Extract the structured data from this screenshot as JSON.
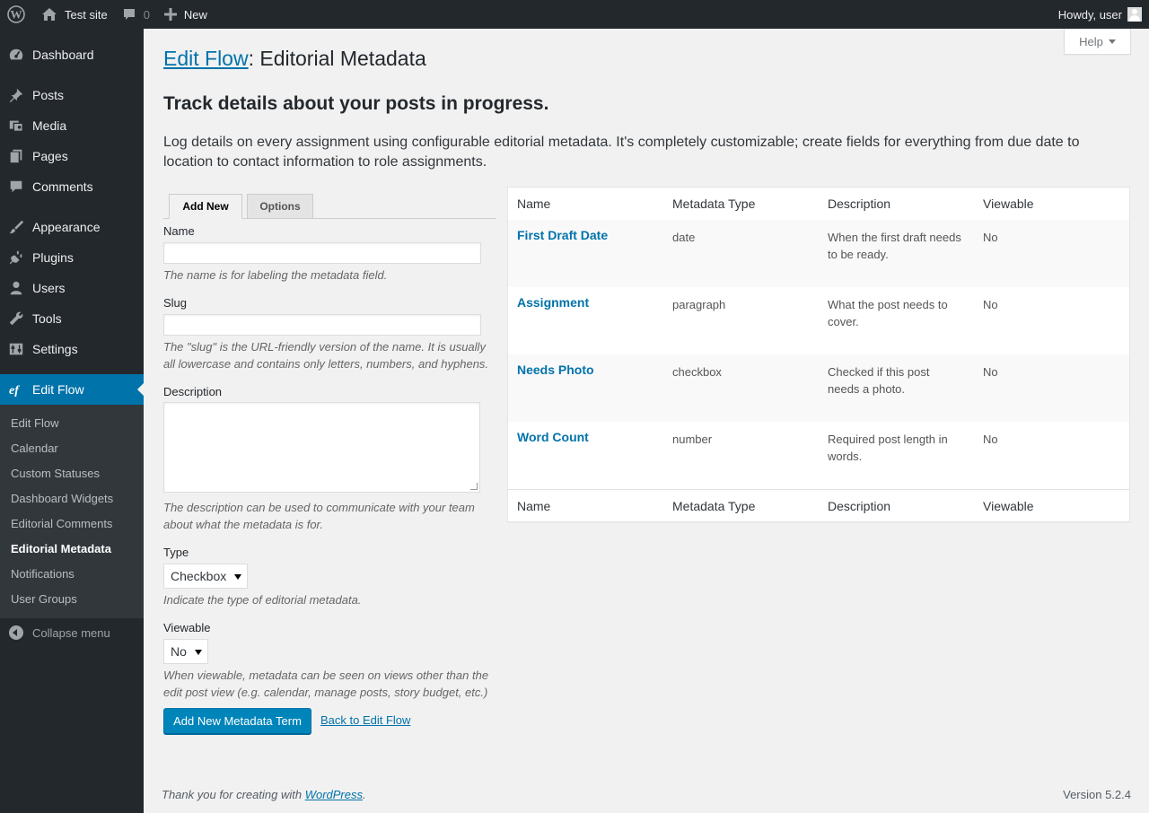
{
  "adminbar": {
    "site_name": "Test site",
    "comments_count": "0",
    "new_label": "New",
    "howdy": "Howdy, user"
  },
  "sidebar": {
    "items": [
      {
        "label": "Dashboard",
        "icon": "dashboard-icon"
      },
      {
        "label": "Posts",
        "icon": "pin-icon"
      },
      {
        "label": "Media",
        "icon": "media-icon"
      },
      {
        "label": "Pages",
        "icon": "pages-icon"
      },
      {
        "label": "Comments",
        "icon": "comment-icon"
      },
      {
        "label": "Appearance",
        "icon": "brush-icon"
      },
      {
        "label": "Plugins",
        "icon": "plugin-icon"
      },
      {
        "label": "Users",
        "icon": "user-icon"
      },
      {
        "label": "Tools",
        "icon": "wrench-icon"
      },
      {
        "label": "Settings",
        "icon": "settings-icon"
      },
      {
        "label": "Edit Flow",
        "icon": "edit-flow-icon"
      }
    ],
    "submenu": [
      "Edit Flow",
      "Calendar",
      "Custom Statuses",
      "Dashboard Widgets",
      "Editorial Comments",
      "Editorial Metadata",
      "Notifications",
      "User Groups"
    ],
    "collapse_label": "Collapse menu"
  },
  "help_tab": "Help",
  "page": {
    "title_link": "Edit Flow",
    "title_rest": ": Editorial Metadata",
    "subheading": "Track details about your posts in progress.",
    "intro": "Log details on every assignment using configurable editorial metadata. It's completely customizable; create fields for everything from due date to location to contact information to role assignments."
  },
  "tabs": {
    "add_new": "Add New",
    "options": "Options"
  },
  "form": {
    "name_label": "Name",
    "name_value": "",
    "name_help": "The name is for labeling the metadata field.",
    "slug_label": "Slug",
    "slug_value": "",
    "slug_help": "The \"slug\" is the URL-friendly version of the name. It is usually all lowercase and contains only letters, numbers, and hyphens.",
    "description_label": "Description",
    "description_help": "The description can be used to communicate with your team about what the metadata is for.",
    "type_label": "Type",
    "type_value": "Checkbox",
    "type_help": "Indicate the type of editorial metadata.",
    "viewable_label": "Viewable",
    "viewable_value": "No",
    "viewable_help": "When viewable, metadata can be seen on views other than the edit post view (e.g. calendar, manage posts, story budget, etc.)",
    "submit_label": "Add New Metadata Term",
    "back_label": "Back to Edit Flow"
  },
  "table": {
    "headers": [
      "Name",
      "Metadata Type",
      "Description",
      "Viewable"
    ],
    "rows": [
      {
        "name": "First Draft Date",
        "type": "date",
        "description": "When the first draft needs to be ready.",
        "viewable": "No"
      },
      {
        "name": "Assignment",
        "type": "paragraph",
        "description": "What the post needs to cover.",
        "viewable": "No"
      },
      {
        "name": "Needs Photo",
        "type": "checkbox",
        "description": "Checked if this post needs a photo.",
        "viewable": "No"
      },
      {
        "name": "Word Count",
        "type": "number",
        "description": "Required post length in words.",
        "viewable": "No"
      }
    ]
  },
  "footer": {
    "thanks_prefix": "Thank you for creating with ",
    "wordpress_link": "WordPress",
    "thanks_suffix": ".",
    "version": "Version 5.2.4"
  },
  "colors": {
    "accent": "#0073aa",
    "button": "#0085ba",
    "sidebar_bg": "#23282d"
  }
}
